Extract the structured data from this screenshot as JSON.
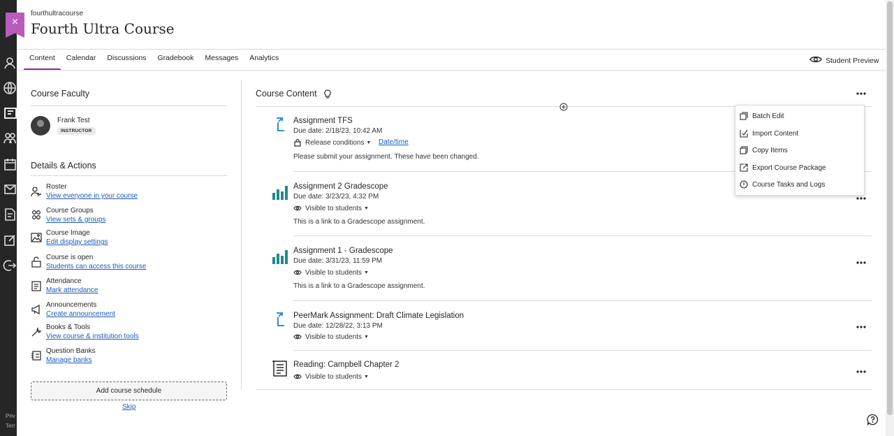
{
  "course": {
    "id": "fourthultracourse",
    "title": "Fourth Ultra Course",
    "close_symbol": "×"
  },
  "rail": {
    "footer_lines": [
      "Priv",
      "Terr"
    ]
  },
  "nav": {
    "tabs": [
      {
        "label": "Content"
      },
      {
        "label": "Calendar"
      },
      {
        "label": "Discussions"
      },
      {
        "label": "Gradebook"
      },
      {
        "label": "Messages"
      },
      {
        "label": "Analytics"
      }
    ],
    "student_preview": "Student Preview"
  },
  "faculty": {
    "title": "Course Faculty",
    "name": "Frank Test",
    "role": "INSTRUCTOR"
  },
  "details": {
    "title": "Details & Actions",
    "actions": [
      {
        "label": "Roster",
        "link": "View everyone in your course"
      },
      {
        "label": "Course Groups",
        "link": "View sets & groups"
      },
      {
        "label": "Course Image",
        "link": "Edit display settings"
      },
      {
        "label": "Course is open",
        "link": "Students can access this course"
      },
      {
        "label": "Attendance",
        "link": "Mark attendance"
      },
      {
        "label": "Announcements",
        "link": "Create announcement"
      },
      {
        "label": "Books & Tools",
        "link": "View course & institution tools"
      },
      {
        "label": "Question Banks",
        "link": "Manage banks"
      }
    ],
    "add_schedule": "Add course schedule",
    "skip": "Skip"
  },
  "content": {
    "title": "Course Content",
    "items": [
      {
        "title": "Assignment TFS",
        "due": "Due date: 2/18/23, 10:42 AM",
        "visibility": "Release conditions",
        "extra_link": "Date/time",
        "description": "Please submit your assignment. These have been changed."
      },
      {
        "title": "Assignment 2 Gradescope",
        "due": "Due date: 3/23/23, 4:32 PM",
        "visibility": "Visible to students",
        "description": "This is a link to a Gradescope assignment."
      },
      {
        "title": "Assignment 1 - Gradescope",
        "due": "Due date: 3/31/23, 11:59 PM",
        "visibility": "Visible to students",
        "description": "This is a link to a Gradescope assignment."
      },
      {
        "title": "PeerMark Assignment: Draft Climate Legislation",
        "due": "Due date: 12/28/22, 3:13 PM",
        "visibility": "Visible to students"
      },
      {
        "title": "Reading: Campbell Chapter 2",
        "visibility": "Visible to students"
      }
    ]
  },
  "menu": {
    "items": [
      {
        "label": "Batch Edit"
      },
      {
        "label": "Import Content"
      },
      {
        "label": "Copy Items"
      },
      {
        "label": "Export Course Package"
      },
      {
        "label": "Course Tasks and Logs"
      }
    ]
  },
  "colors": {
    "accent": "#8c2d93",
    "close_button": "#b85bbd",
    "link": "#1d5bb8",
    "gradescope_teal": "#1f8a8c",
    "turnitin_blue": "#2b8fd6"
  }
}
